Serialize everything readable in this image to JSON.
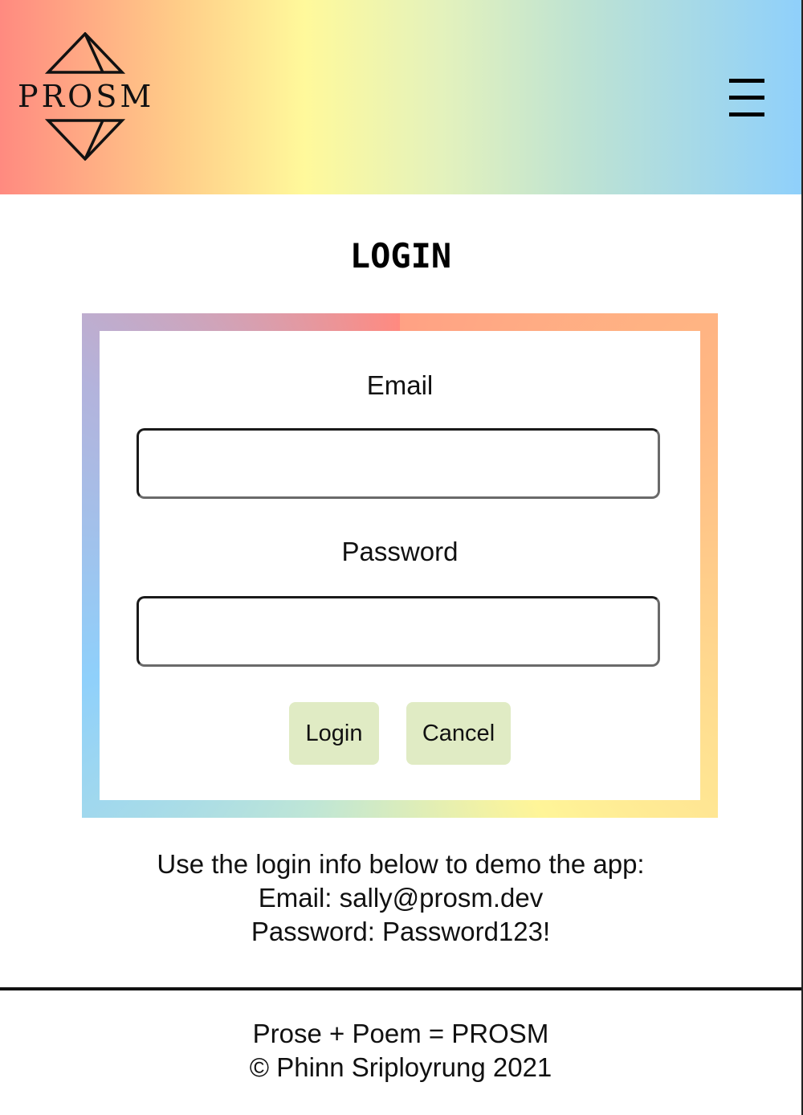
{
  "header": {
    "logo_text": "PROSM",
    "menu_icon": "hamburger-menu-icon",
    "gradient_colors": [
      "#ff8a80",
      "#ffcc88",
      "#fff99b",
      "#e4f2bc",
      "#bfe3d2",
      "#8fd0fb"
    ]
  },
  "page": {
    "title": "LOGIN"
  },
  "form": {
    "email_label": "Email",
    "email_value": "",
    "password_label": "Password",
    "password_value": "",
    "login_button": "Login",
    "cancel_button": "Cancel",
    "button_color": "#e0ebc4"
  },
  "demo": {
    "intro": "Use the login info below to demo the app:",
    "email_line": "Email: sally@prosm.dev",
    "password_line": "Password: Password123!"
  },
  "footer": {
    "tagline": "Prose + Poem = PROSM",
    "copyright": "© Phinn Sriployrung 2021"
  }
}
